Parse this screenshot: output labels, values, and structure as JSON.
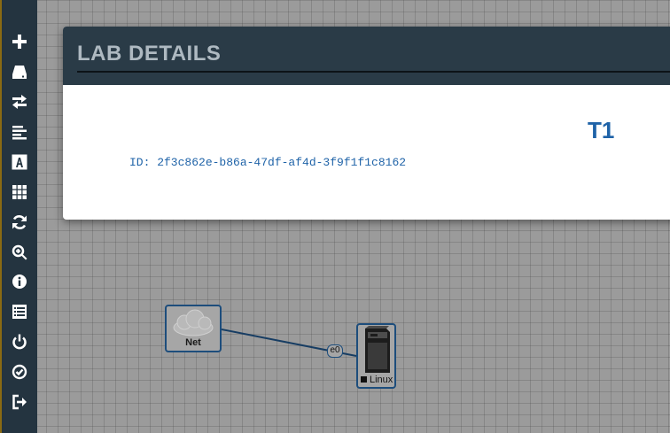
{
  "sidebar": {
    "items": [
      {
        "icon": "plus-icon",
        "name": "add-object-button"
      },
      {
        "icon": "drive-icon",
        "name": "nodes-button"
      },
      {
        "icon": "swap-arrows-icon",
        "name": "networks-button"
      },
      {
        "icon": "align-left-icon",
        "name": "startup-configs-button"
      },
      {
        "icon": "text-a-icon",
        "name": "text-objects-button"
      },
      {
        "icon": "grid-icon",
        "name": "arrange-grid-button"
      },
      {
        "icon": "refresh-icon",
        "name": "refresh-button"
      },
      {
        "icon": "zoom-icon",
        "name": "zoom-button"
      },
      {
        "icon": "info-icon",
        "name": "lab-details-button"
      },
      {
        "icon": "list-icon",
        "name": "lab-list-button"
      },
      {
        "icon": "power-icon",
        "name": "close-lab-button"
      },
      {
        "icon": "check-circle-icon",
        "name": "lock-lab-button"
      },
      {
        "icon": "sign-out-icon",
        "name": "logout-button"
      }
    ]
  },
  "modal": {
    "title": "LAB DETAILS",
    "lab_name": "T1",
    "lab_id": "ID: 2f3c862e-b86a-47df-af4d-3f9f1f1c8162"
  },
  "topology": {
    "nodes": [
      {
        "name": "Net",
        "type": "cloud-icon"
      },
      {
        "name": "Linux",
        "type": "server-tower-icon",
        "status": "stopped"
      }
    ],
    "links": [
      {
        "from": "Net",
        "to": "Linux",
        "interface": "e0"
      }
    ]
  },
  "colors": {
    "sidebar_bg": "#243440",
    "header_bg": "#2a3b47",
    "accent_text": "#1f63a8",
    "canvas_bg": "#9b9b9b"
  }
}
